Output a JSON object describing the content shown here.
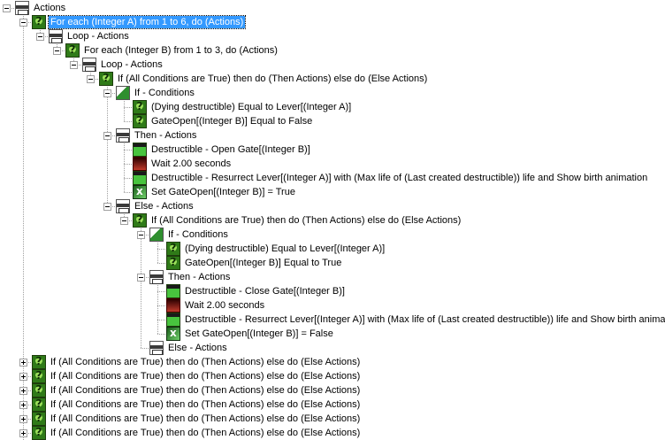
{
  "rows": [
    {
      "text": "Actions",
      "icon": "actions-icon",
      "level": 0,
      "toggle": "minus"
    },
    {
      "text": "For each (Integer A) from 1 to 6, do (Actions)",
      "icon": "condition-icon",
      "level": 1,
      "toggle": "minus",
      "selected": true
    },
    {
      "text": "Loop - Actions",
      "icon": "actions-icon",
      "level": 2,
      "toggle": "minus"
    },
    {
      "text": "For each (Integer B) from 1 to 3, do (Actions)",
      "icon": "condition-icon",
      "level": 3,
      "toggle": "minus"
    },
    {
      "text": "Loop - Actions",
      "icon": "actions-icon",
      "level": 4,
      "toggle": "minus"
    },
    {
      "text": "If (All Conditions are True) then do (Then Actions) else do (Else Actions)",
      "icon": "condition-icon",
      "level": 5,
      "toggle": "minus"
    },
    {
      "text": "If - Conditions",
      "icon": "if-conditions-icon",
      "level": 6,
      "toggle": "minus"
    },
    {
      "text": "(Dying destructible) Equal to Lever[(Integer A)]",
      "icon": "condition-icon",
      "level": 7
    },
    {
      "text": "GateOpen[(Integer B)] Equal to False",
      "icon": "condition-icon",
      "level": 7
    },
    {
      "text": "Then - Actions",
      "icon": "actions-icon",
      "level": 6,
      "toggle": "minus"
    },
    {
      "text": "Destructible - Open Gate[(Integer B)]",
      "icon": "destructible-icon",
      "level": 7
    },
    {
      "text": "Wait 2.00 seconds",
      "icon": "wait-icon",
      "level": 7
    },
    {
      "text": "Destructible - Resurrect Lever[(Integer A)] with (Max life of (Last created destructible)) life and Show birth animation",
      "icon": "destructible-icon",
      "level": 7
    },
    {
      "text": "Set GateOpen[(Integer B)] = True",
      "icon": "set-variable-icon",
      "level": 7
    },
    {
      "text": "Else - Actions",
      "icon": "actions-icon",
      "level": 6,
      "toggle": "minus"
    },
    {
      "text": "If (All Conditions are True) then do (Then Actions) else do (Else Actions)",
      "icon": "condition-icon",
      "level": 7,
      "toggle": "minus"
    },
    {
      "text": "If - Conditions",
      "icon": "if-conditions-icon",
      "level": 8,
      "toggle": "minus"
    },
    {
      "text": "(Dying destructible) Equal to Lever[(Integer A)]",
      "icon": "condition-icon",
      "level": 9
    },
    {
      "text": "GateOpen[(Integer B)] Equal to True",
      "icon": "condition-icon",
      "level": 9
    },
    {
      "text": "Then - Actions",
      "icon": "actions-icon",
      "level": 8,
      "toggle": "minus"
    },
    {
      "text": "Destructible - Close Gate[(Integer B)]",
      "icon": "destructible-icon",
      "level": 9
    },
    {
      "text": "Wait 2.00 seconds",
      "icon": "wait-icon",
      "level": 9
    },
    {
      "text": "Destructible - Resurrect Lever[(Integer A)] with (Max life of (Last created destructible)) life and Show birth animation",
      "icon": "destructible-icon",
      "level": 9
    },
    {
      "text": "Set GateOpen[(Integer B)] = False",
      "icon": "set-variable-icon",
      "level": 9
    },
    {
      "text": "Else - Actions",
      "icon": "actions-icon",
      "level": 8
    },
    {
      "text": "If (All Conditions are True) then do (Then Actions) else do (Else Actions)",
      "icon": "condition-icon",
      "level": 1,
      "toggle": "plus"
    },
    {
      "text": "If (All Conditions are True) then do (Then Actions) else do (Else Actions)",
      "icon": "condition-icon",
      "level": 1,
      "toggle": "plus"
    },
    {
      "text": "If (All Conditions are True) then do (Then Actions) else do (Else Actions)",
      "icon": "condition-icon",
      "level": 1,
      "toggle": "plus"
    },
    {
      "text": "If (All Conditions are True) then do (Then Actions) else do (Else Actions)",
      "icon": "condition-icon",
      "level": 1,
      "toggle": "plus"
    },
    {
      "text": "If (All Conditions are True) then do (Then Actions) else do (Else Actions)",
      "icon": "condition-icon",
      "level": 1,
      "toggle": "plus"
    },
    {
      "text": "If (All Conditions are True) then do (Then Actions) else do (Else Actions)",
      "icon": "condition-icon",
      "level": 1,
      "toggle": "plus"
    }
  ],
  "colors": {
    "selection": "#3399ff",
    "tree_lines": "#a0a0a0",
    "background": "#ffffff"
  }
}
